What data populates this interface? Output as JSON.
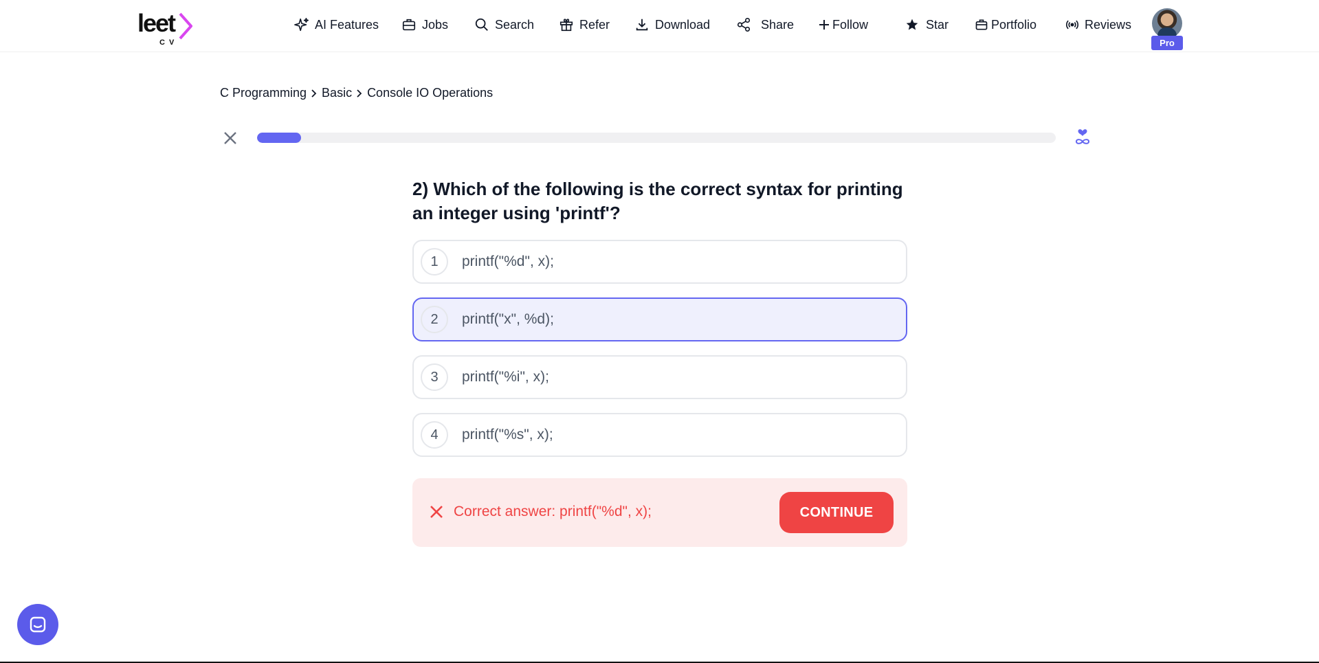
{
  "brand": {
    "logo_word": "leet",
    "logo_sub": "CV",
    "accent": "#d946ef"
  },
  "nav": {
    "items": [
      {
        "label": "AI Features",
        "icon": "sparkles-icon"
      },
      {
        "label": "Jobs",
        "icon": "briefcase-icon"
      },
      {
        "label": "Search",
        "icon": "search-icon"
      },
      {
        "label": "Refer",
        "icon": "gift-icon"
      },
      {
        "label": "Download",
        "icon": "download-icon"
      },
      {
        "label": "Share",
        "icon": "share-icon"
      },
      {
        "label": "Follow",
        "icon": "plus-icon"
      },
      {
        "label": "Star",
        "icon": "star-icon"
      },
      {
        "label": "Portfolio",
        "icon": "portfolio-icon"
      },
      {
        "label": "Reviews",
        "icon": "broadcast-icon"
      }
    ],
    "badge": "Pro"
  },
  "breadcrumb": [
    "C Programming",
    "Basic",
    "Console IO Operations"
  ],
  "progress": {
    "fraction": 0.055,
    "color": "#6366f1"
  },
  "quiz": {
    "question": "2) Which of the following is the correct syntax for printing an integer using 'printf'?",
    "options": [
      {
        "num": "1",
        "text": "printf(\"%d\", x);"
      },
      {
        "num": "2",
        "text": "printf(\"x\", %d);"
      },
      {
        "num": "3",
        "text": "printf(\"%i\", x);"
      },
      {
        "num": "4",
        "text": "printf(\"%s\", x);"
      }
    ],
    "selected_index": 1
  },
  "feedback": {
    "message": "Correct answer: printf(\"%d\", x);",
    "button": "CONTINUE",
    "color": "#ef4444"
  }
}
